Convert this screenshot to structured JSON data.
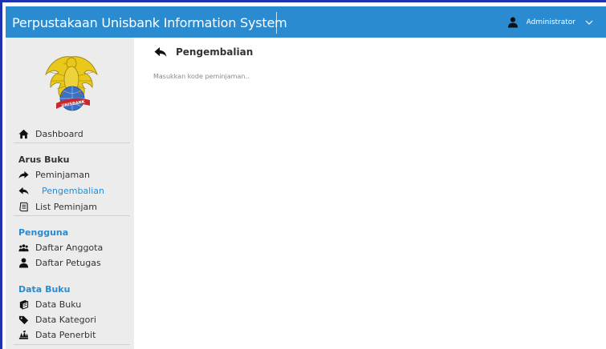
{
  "header": {
    "app_title": "Perpustakaan Unisbank Information System",
    "user_name": "Administrator"
  },
  "sidebar": {
    "logo_text": "UNISBANK",
    "dashboard": "Dashboard",
    "sections": [
      {
        "title": "Arus Buku",
        "color": "#333333",
        "items": [
          "Peminjaman",
          "Pengembalian",
          "List Peminjam"
        ]
      },
      {
        "title": "Pengguna",
        "color": "#2a8bd0",
        "items": [
          "Daftar Anggota",
          "Daftar Petugas"
        ]
      },
      {
        "title": "Data Buku",
        "color": "#2a8bd0",
        "items": [
          "Data Buku",
          "Data Kategori",
          "Data Penerbit"
        ]
      }
    ],
    "active_item": "Pengembalian"
  },
  "main": {
    "title": "Pengembalian",
    "input_placeholder": "Masukkan kode peminjaman.."
  },
  "colors": {
    "topbar": "#2a8bd0",
    "sidebar_bg": "#ececec",
    "accent": "#2a8bd0",
    "frame": "#1f33b0"
  }
}
